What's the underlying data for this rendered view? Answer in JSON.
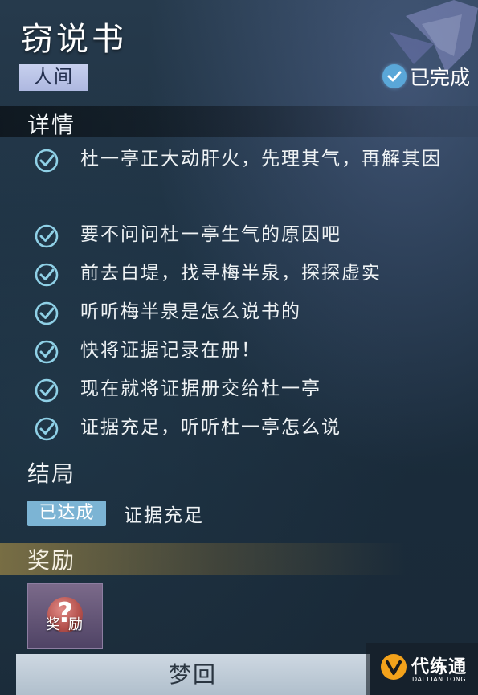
{
  "quest": {
    "title": "窃说书",
    "realm_tag": "人间",
    "status": "已完成"
  },
  "details": {
    "heading": "详情",
    "tasks": [
      {
        "text": "杜一亭正大动肝火，先理其气，再解其因",
        "completed": true
      },
      {
        "text": "要不问问杜一亭生气的原因吧",
        "completed": true
      },
      {
        "text": "前去白堤，找寻梅半泉，探探虚实",
        "completed": true
      },
      {
        "text": "听听梅半泉是怎么说书的",
        "completed": true
      },
      {
        "text": "快将证据记录在册！",
        "completed": true
      },
      {
        "text": "现在就将证据册交给杜一亭",
        "completed": true
      },
      {
        "text": "证据充足，听听杜一亭怎么说",
        "completed": true
      }
    ]
  },
  "ending": {
    "heading": "结局",
    "badge": "已达成",
    "text": "证据充足"
  },
  "reward": {
    "heading": "奖励",
    "item_label": "奖励",
    "item_icon": "mystery-reward-icon"
  },
  "action": {
    "button_label": "梦回"
  },
  "watermark": {
    "brand_cn": "代练通",
    "brand_en": "DAI LIAN TONG"
  },
  "colors": {
    "check": "#8fd0e6",
    "status_badge": "#5aa7d8",
    "achieved_badge": "#7cb4d4",
    "realm_tag": "#b9c3e7",
    "reward_bar": "#96824a",
    "button": "#c3ceda"
  }
}
